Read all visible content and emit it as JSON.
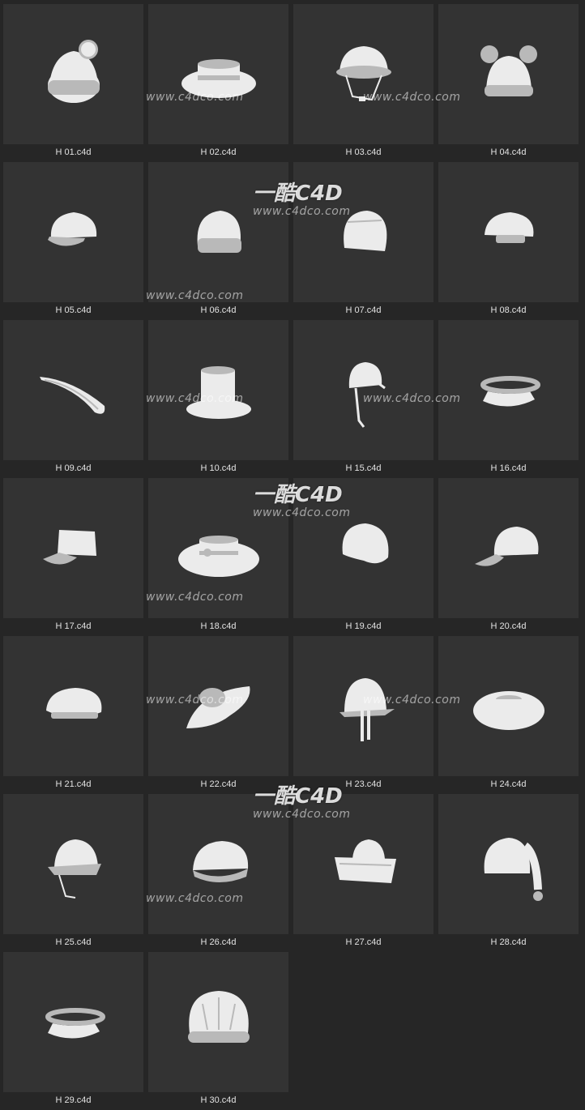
{
  "items": [
    {
      "label": "H 01.c4d",
      "icon": "beanie-pompom-icon"
    },
    {
      "label": "H 02.c4d",
      "icon": "boater-hat-icon"
    },
    {
      "label": "H 03.c4d",
      "icon": "bucket-hat-strap-icon"
    },
    {
      "label": "H 04.c4d",
      "icon": "beanie-ears-icon"
    },
    {
      "label": "H 05.c4d",
      "icon": "newsboy-cap-icon"
    },
    {
      "label": "H 06.c4d",
      "icon": "beanie-icon"
    },
    {
      "label": "H 07.c4d",
      "icon": "slouch-beanie-icon"
    },
    {
      "label": "H 08.c4d",
      "icon": "chef-beret-icon"
    },
    {
      "label": "H 09.c4d",
      "icon": "tricorn-hat-icon"
    },
    {
      "label": "H 10.c4d",
      "icon": "top-hat-icon"
    },
    {
      "label": "H 15.c4d",
      "icon": "bonnet-icon"
    },
    {
      "label": "H 16.c4d",
      "icon": "visor-icon"
    },
    {
      "label": "H 17.c4d",
      "icon": "cadet-cap-icon"
    },
    {
      "label": "H 18.c4d",
      "icon": "bow-boater-icon"
    },
    {
      "label": "H 19.c4d",
      "icon": "skull-cap-icon"
    },
    {
      "label": "H 20.c4d",
      "icon": "baseball-cap-icon"
    },
    {
      "label": "H 21.c4d",
      "icon": "beret-icon"
    },
    {
      "label": "H 22.c4d",
      "icon": "floppy-hat-icon"
    },
    {
      "label": "H 23.c4d",
      "icon": "cloche-ribbon-icon"
    },
    {
      "label": "H 24.c4d",
      "icon": "flat-boater-icon"
    },
    {
      "label": "H 25.c4d",
      "icon": "bucket-hat-icon"
    },
    {
      "label": "H 26.c4d",
      "icon": "flat-cap-icon"
    },
    {
      "label": "H 27.c4d",
      "icon": "sailor-hat-icon"
    },
    {
      "label": "H 28.c4d",
      "icon": "nightcap-icon"
    },
    {
      "label": "H 29.c4d",
      "icon": "visor-icon"
    },
    {
      "label": "H 30.c4d",
      "icon": "shower-cap-icon"
    }
  ],
  "watermark": {
    "url_text": "www.c4dco.com",
    "logo_text": "一酷C4D"
  },
  "colors": {
    "background": "#262626",
    "thumb": "#333333",
    "model": "#e9e9e9",
    "label": "#e2e2e2"
  }
}
